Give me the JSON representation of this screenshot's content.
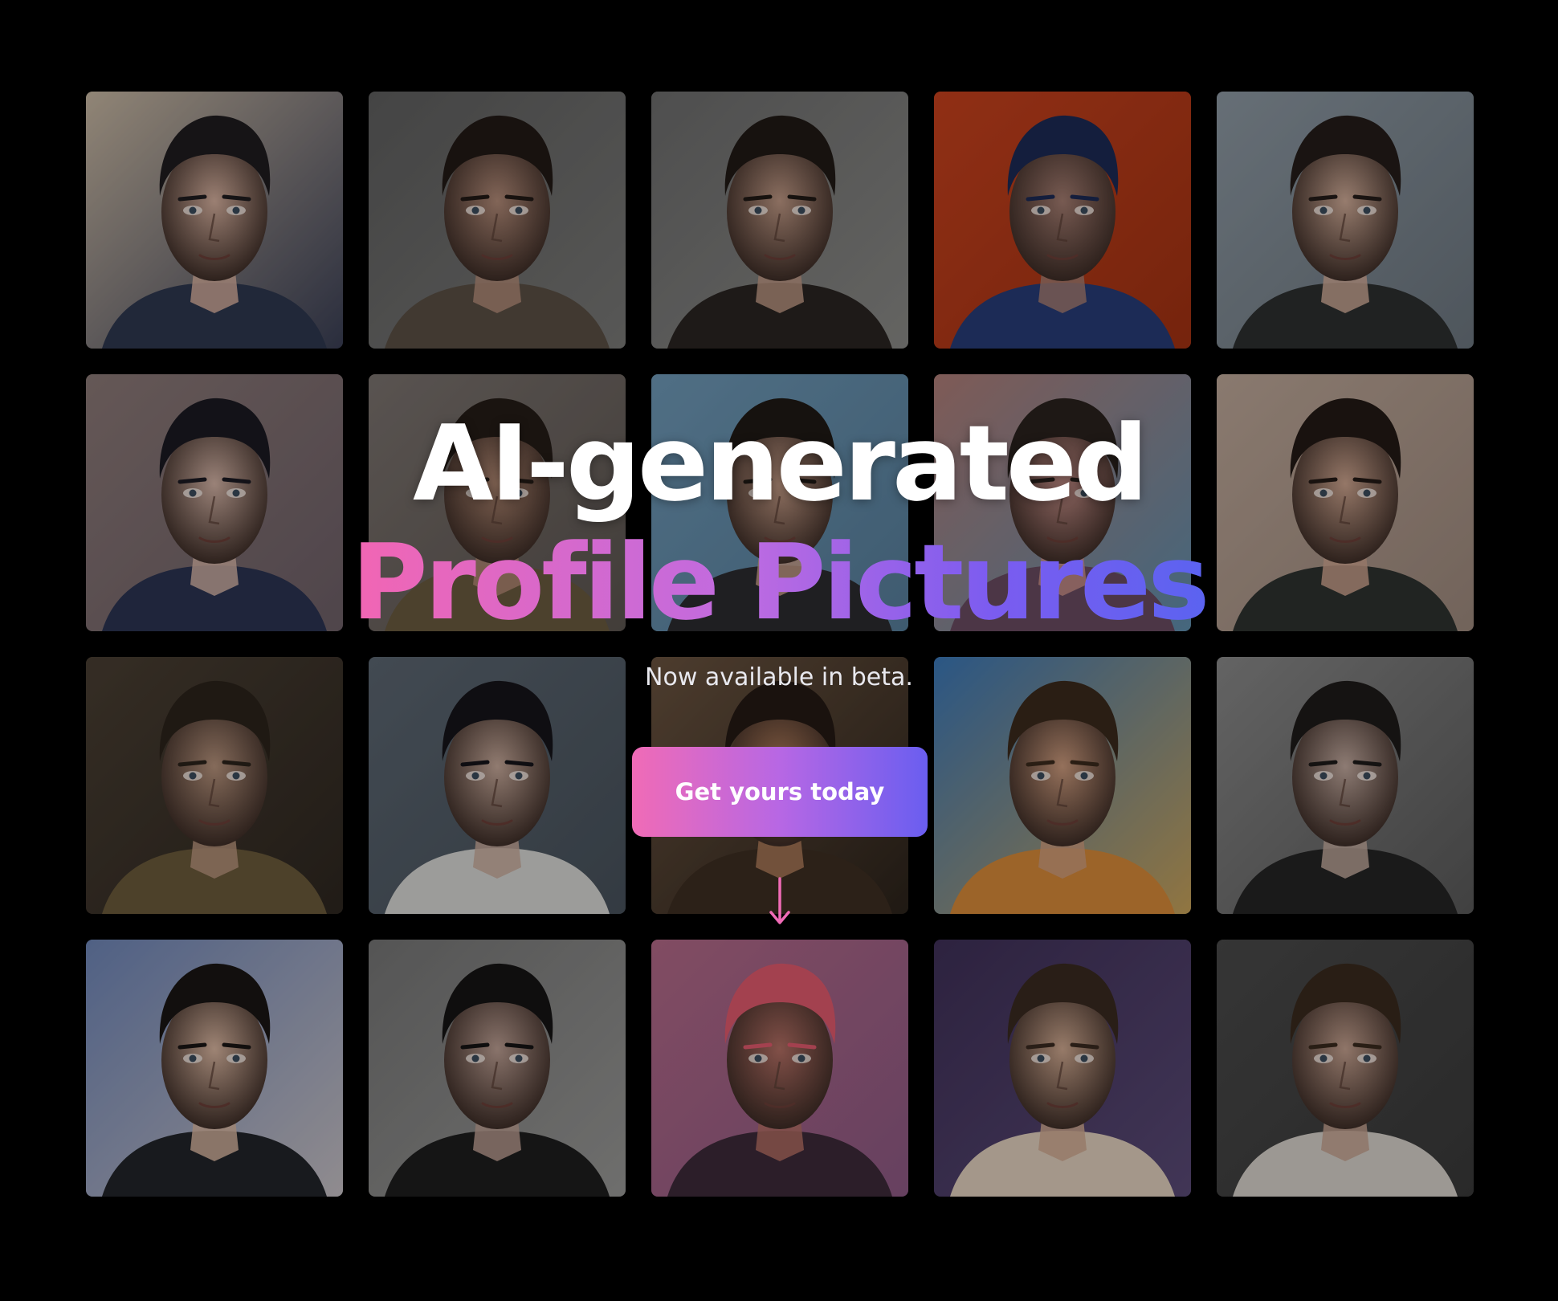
{
  "hero": {
    "headline_line1": "AI-generated",
    "headline_line2": "Profile Pictures",
    "subtitle": "Now available in beta.",
    "cta_label": "Get yours today",
    "arrow_icon": "arrow-down-icon"
  },
  "colors": {
    "gradient_start": "#f266b3",
    "gradient_mid": "#b767e4",
    "gradient_end": "#5b63f0",
    "background": "#000000",
    "arrow": "#f06bb6"
  },
  "portraits": [
    {
      "bg": "#c9b9a4",
      "bg2": "#3a3f55",
      "skin": "#d8b2a0",
      "hair": "#1f1c1f",
      "cloth": "#2f3850"
    },
    {
      "bg": "#5f5f5f",
      "bg2": "#7a7a78",
      "skin": "#b58d7a",
      "hair": "#221a16",
      "cloth": "#5a4f44"
    },
    {
      "bg": "#6d6d6d",
      "bg2": "#8b8b88",
      "skin": "#c19a86",
      "hair": "#201915",
      "cloth": "#2a2522"
    },
    {
      "bg": "#c8421e",
      "bg2": "#a33212",
      "skin": "#a67e72",
      "hair": "#1d2a55",
      "cloth": "#283c78"
    },
    {
      "bg": "#8e9aa4",
      "bg2": "#6d7780",
      "skin": "#d2ad99",
      "hair": "#241c19",
      "cloth": "#2d3030"
    },
    {
      "bg": "#8c7a78",
      "bg2": "#6e6068",
      "skin": "#d6b5a7",
      "hair": "#1b1a22",
      "cloth": "#2b3452"
    },
    {
      "bg": "#7c7470",
      "bg2": "#5c5550",
      "skin": "#b38a74",
      "hair": "#251c17",
      "cloth": "#6a5a3f"
    },
    {
      "bg": "#6f9ab8",
      "bg2": "#577e9b",
      "skin": "#caa08a",
      "hair": "#1f1915",
      "cloth": "#2c2c30"
    },
    {
      "bg": "#b07e78",
      "bg2": "#5f8fae",
      "skin": "#c9918a",
      "hair": "#2a221e",
      "cloth": "#6a4c62"
    },
    {
      "bg": "#bfa99a",
      "bg2": "#9e8a7e",
      "skin": "#cfa690",
      "hair": "#231a15",
      "cloth": "#2f3330"
    },
    {
      "bg": "#4a3f33",
      "bg2": "#2e2720",
      "skin": "#b9957e",
      "hair": "#2c231b",
      "cloth": "#6b5a3b"
    },
    {
      "bg": "#5c6772",
      "bg2": "#48525c",
      "skin": "#c9ab9c",
      "hair": "#16141a",
      "cloth": "#d9d9d6"
    },
    {
      "bg": "#6b5440",
      "bg2": "#2c231b",
      "skin": "#b07c5a",
      "hair": "#241a14",
      "cloth": "#3e2e22"
    },
    {
      "bg": "#3b78b8",
      "bg2": "#c9a35a",
      "skin": "#cf9d7f",
      "hair": "#3b2a1d",
      "cloth": "#d98b3a"
    },
    {
      "bg": "#8a8a8a",
      "bg2": "#5a5a5a",
      "skin": "#c4aba0",
      "hair": "#1e1b1a",
      "cloth": "#242424"
    },
    {
      "bg": "#6f86b8",
      "bg2": "#c8c2c6",
      "skin": "#dcb8a2",
      "hair": "#1a1614",
      "cloth": "#22252a"
    },
    {
      "bg": "#767676",
      "bg2": "#9a9a98",
      "skin": "#bfa195",
      "hair": "#161414",
      "cloth": "#1e1e1e"
    },
    {
      "bg": "#b46a88",
      "bg2": "#8e5a86",
      "skin": "#b57065",
      "hair": "#e25a6e",
      "cloth": "#3e2a3a"
    },
    {
      "bg": "#3f3058",
      "bg2": "#5b4b78",
      "skin": "#d2ab92",
      "hair": "#3a2a20",
      "cloth": "#e3d2bf"
    },
    {
      "bg": "#4a4a4a",
      "bg2": "#3a3a3a",
      "skin": "#c7a391",
      "hair": "#3a2a1e",
      "cloth": "#d8d3cc"
    }
  ]
}
